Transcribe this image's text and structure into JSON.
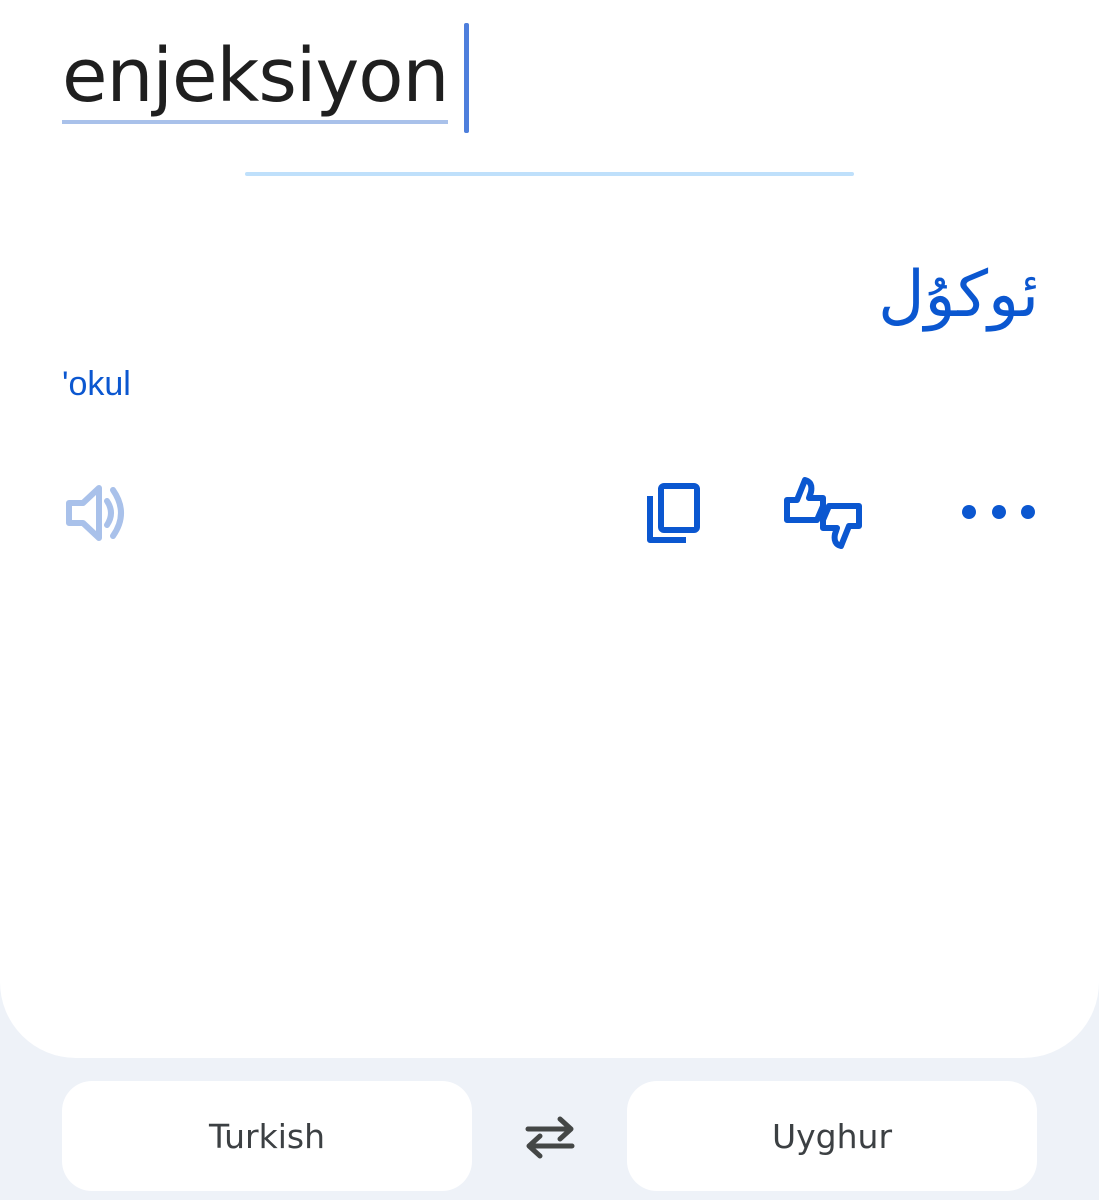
{
  "input": {
    "text": "enjeksiyon"
  },
  "output": {
    "translation": "ئوكۇل",
    "romanization": "'okul"
  },
  "actions": {
    "listen_icon": "speaker-icon",
    "copy_icon": "copy-icon",
    "rate_icon": "thumbs-up-down-icon",
    "more_icon": "more-horizontal-icon"
  },
  "languages": {
    "source": "Turkish",
    "target": "Uyghur",
    "swap_icon": "swap-arrows-icon"
  },
  "colors": {
    "accent": "#0b57d0",
    "speaker_disabled": "#a9c1ea",
    "background": "#eef2f8"
  }
}
